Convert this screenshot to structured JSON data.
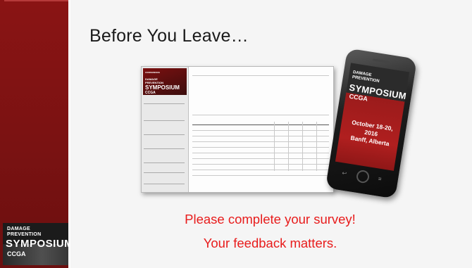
{
  "slide": {
    "title": "Before You Leave…",
    "cta_line1": "Please complete your survey!",
    "cta_line2": "Your feedback matters.",
    "accent_color": "#e81c1c",
    "band_color": "#7a1212"
  },
  "corner_logo": {
    "line1": "DAMAGE",
    "line2": "PREVENTION",
    "line3": "SYMPOSIUM",
    "line4": "CCGA"
  },
  "phone_screen": {
    "line1": "DAMAGE",
    "line2": "PREVENTION",
    "line3": "SYMPOSIUM",
    "line4": "CCGA",
    "date": "October 18-20, 2016",
    "place": "Banff, Alberta"
  }
}
